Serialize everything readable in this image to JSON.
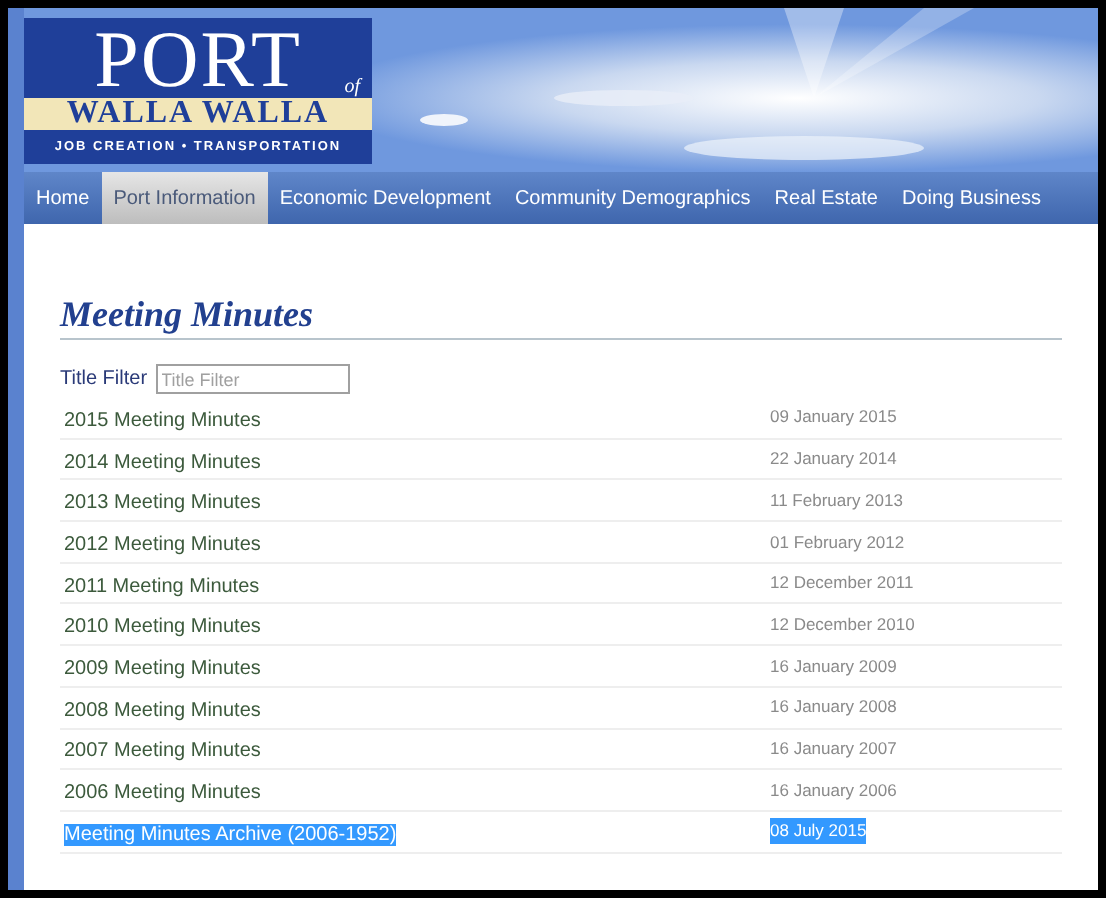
{
  "logo": {
    "title": "PORT",
    "of": "of",
    "name": "WALLA WALLA",
    "tagline": "JOB CREATION • TRANSPORTATION"
  },
  "nav": [
    {
      "label": "Home",
      "selected": false
    },
    {
      "label": "Port Information",
      "selected": true
    },
    {
      "label": "Economic Development",
      "selected": false
    },
    {
      "label": "Community Demographics",
      "selected": false
    },
    {
      "label": "Real Estate",
      "selected": false
    },
    {
      "label": "Doing Business",
      "selected": false
    }
  ],
  "heading": "Meeting Minutes",
  "filter": {
    "label": "Title Filter",
    "placeholder": "Title Filter"
  },
  "rows": [
    {
      "title": "2015 Meeting Minutes",
      "date": "09 January 2015",
      "highlighted": false
    },
    {
      "title": "2014 Meeting Minutes",
      "date": "22 January 2014",
      "highlighted": false
    },
    {
      "title": "2013 Meeting Minutes",
      "date": "11 February 2013",
      "highlighted": false
    },
    {
      "title": "2012 Meeting Minutes",
      "date": "01 February 2012",
      "highlighted": false
    },
    {
      "title": "2011 Meeting Minutes",
      "date": "12 December 2011",
      "highlighted": false
    },
    {
      "title": "2010 Meeting Minutes",
      "date": "12 December 2010",
      "highlighted": false
    },
    {
      "title": "2009 Meeting Minutes",
      "date": "16 January 2009",
      "highlighted": false
    },
    {
      "title": "2008 Meeting Minutes",
      "date": "16 January 2008",
      "highlighted": false
    },
    {
      "title": "2007 Meeting Minutes",
      "date": "16 January 2007",
      "highlighted": false
    },
    {
      "title": "2006 Meeting Minutes",
      "date": "16 January 2006",
      "highlighted": false
    },
    {
      "title": "Meeting Minutes Archive (2006-1952)",
      "date": "08 July 2015",
      "highlighted": true
    }
  ]
}
